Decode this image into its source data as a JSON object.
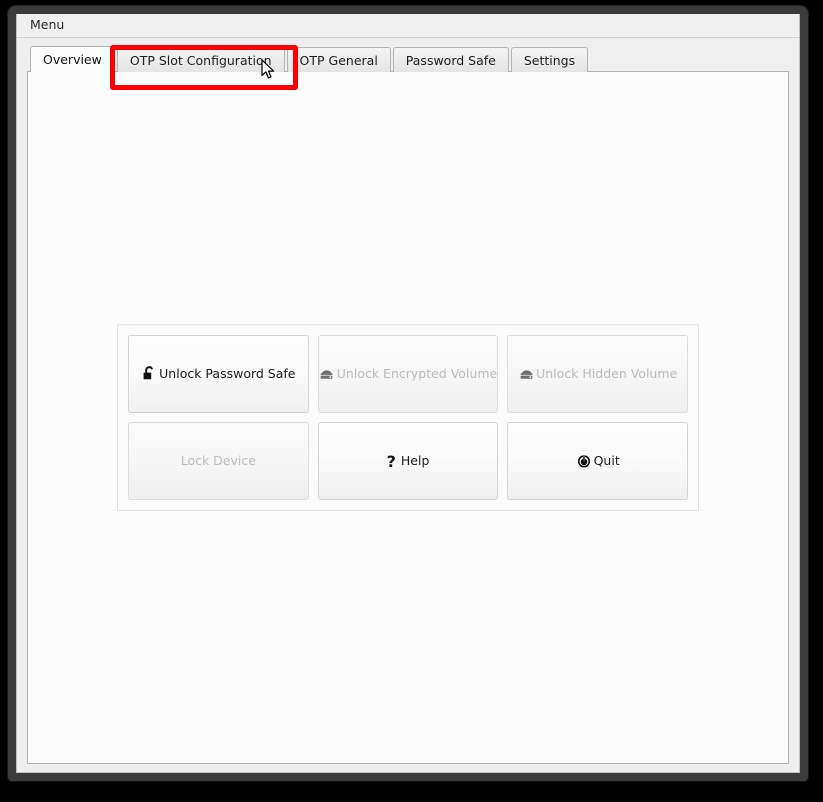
{
  "window": {
    "menubar": {
      "items": [
        {
          "label": "Menu",
          "name": "menu-item-menu"
        }
      ]
    }
  },
  "tabs": [
    {
      "label": "Overview",
      "name": "tab-overview",
      "active": true
    },
    {
      "label": "OTP Slot Configuration",
      "name": "tab-otp-slot-configuration",
      "active": false
    },
    {
      "label": "OTP General",
      "name": "tab-otp-general",
      "active": false
    },
    {
      "label": "Password Safe",
      "name": "tab-password-safe",
      "active": false
    },
    {
      "label": "Settings",
      "name": "tab-settings",
      "active": false
    }
  ],
  "overview": {
    "actions": [
      {
        "label": "Unlock Password Safe",
        "name": "unlock-password-safe-button",
        "icon": "open-padlock-icon",
        "enabled": true
      },
      {
        "label": "Unlock Encrypted Volume",
        "name": "unlock-encrypted-volume-button",
        "icon": "hard-drive-icon",
        "enabled": false
      },
      {
        "label": "Unlock Hidden Volume",
        "name": "unlock-hidden-volume-button",
        "icon": "hard-drive-icon",
        "enabled": false
      },
      {
        "label": "Lock Device",
        "name": "lock-device-button",
        "icon": "none",
        "enabled": false
      },
      {
        "label": "Help",
        "name": "help-button",
        "icon": "question-mark-icon",
        "enabled": true
      },
      {
        "label": "Quit",
        "name": "quit-button",
        "icon": "power-icon",
        "enabled": true
      }
    ]
  },
  "annotation": {
    "highlight_color": "#ff0000",
    "target": "OTP Slot Configuration"
  },
  "colors": {
    "window_frame": "#3b3b3b",
    "menubar_bg": "#efefef",
    "panel_bg": "#fcfcfc",
    "tab_active_bg": "#fcfcfc",
    "tab_inactive_bg": "#e9e9e9",
    "disabled_text": "#bcbcbc",
    "text": "#1b1b1b"
  }
}
